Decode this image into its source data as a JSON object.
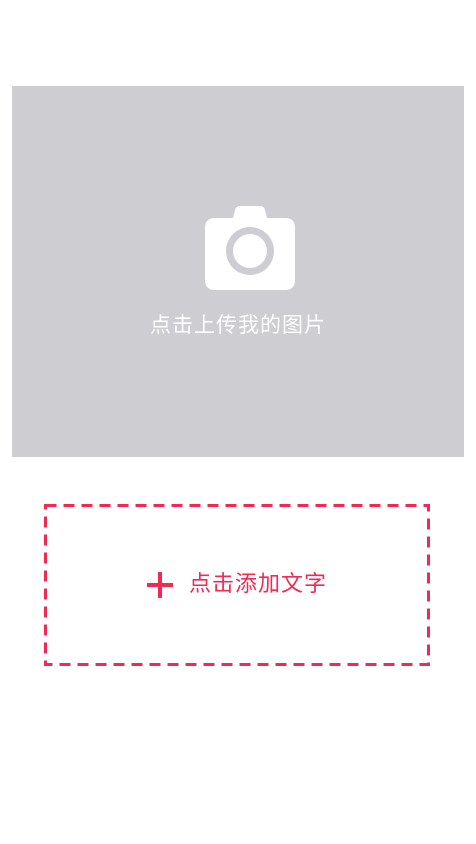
{
  "upload": {
    "icon": "camera-icon",
    "label": "点击上传我的图片",
    "background_color": "#cdcdd2"
  },
  "add_text": {
    "icon": "plus-icon",
    "label": "点击添加文字",
    "accent_color": "#ee2a55"
  }
}
